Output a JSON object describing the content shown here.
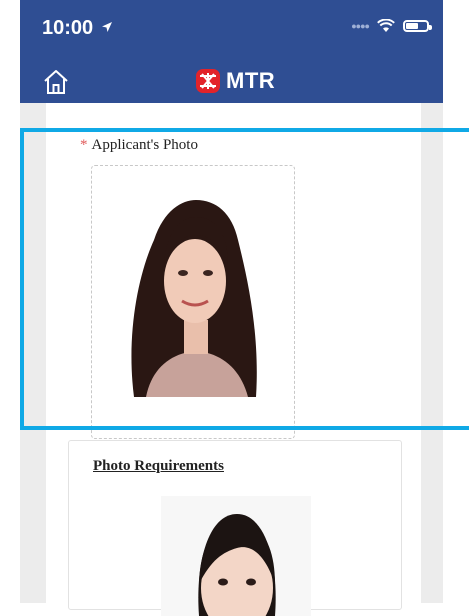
{
  "status_bar": {
    "time": "10:00"
  },
  "header": {
    "brand": "MTR",
    "brand_color": "#2f4e93",
    "logo_color": "#e2232a"
  },
  "form": {
    "required_marker": "*",
    "photo_label": "Applicant's Photo"
  },
  "requirements": {
    "title": "Photo Requirements"
  },
  "highlight_color": "#10a9e6",
  "icons": [
    "location-arrow-icon",
    "wifi-icon",
    "battery-icon",
    "home-icon",
    "mtr-logo-icon"
  ]
}
